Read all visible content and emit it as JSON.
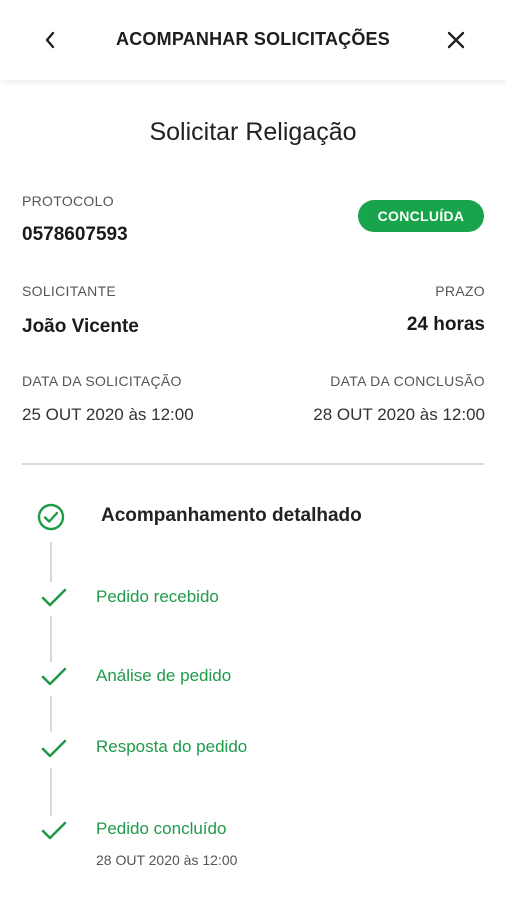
{
  "header": {
    "title": "ACOMPANHAR SOLICITAÇÕES",
    "back_icon": "chevron-left-icon",
    "close_icon": "close-icon"
  },
  "page": {
    "title": "Solicitar Religação"
  },
  "protocol": {
    "label": "PROTOCOLO",
    "value": "0578607593",
    "status": "CONCLUÍDA",
    "status_color": "#18a44b"
  },
  "requester": {
    "label": "SOLICITANTE",
    "value": "João Vicente"
  },
  "deadline": {
    "label": "PRAZO",
    "value": "24 horas"
  },
  "dates": {
    "request_label": "DATA DA SOLICITAÇÃO",
    "request_value": "25 OUT 2020 às 12:00",
    "conclusion_label": "DATA DA CONCLUSÃO",
    "conclusion_value": "28 OUT 2020 às 12:00"
  },
  "timeline": {
    "title": "Acompanhamento detalhado",
    "accent_color": "#1f9a49",
    "steps": [
      {
        "label": "Pedido recebido"
      },
      {
        "label": "Análise de pedido"
      },
      {
        "label": "Resposta do pedido"
      },
      {
        "label": "Pedido concluído",
        "date": "28 OUT 2020 às 12:00"
      }
    ]
  }
}
